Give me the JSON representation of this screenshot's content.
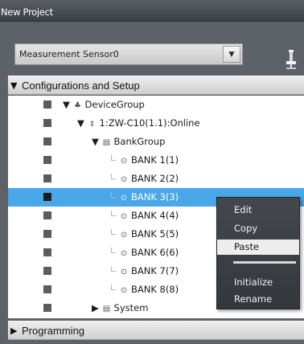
{
  "window": {
    "title": "New Project"
  },
  "dropdown": {
    "value": "Measurement Sensor0",
    "arrow": "▼"
  },
  "icons": {
    "pin": "pin-icon",
    "arrow": "dropdown-arrow-icon"
  },
  "sections": {
    "configurations": {
      "expander": "▼",
      "label": "Configurations and Setup"
    },
    "programming": {
      "expander": "▶",
      "label": "Programming"
    }
  },
  "tree": {
    "device_group": {
      "expander": "▼",
      "icon": "♣",
      "label": "DeviceGroup"
    },
    "controller": {
      "expander": "▼",
      "icon": "‡",
      "label": "1:ZW-C10(1.1):Online"
    },
    "bank_group": {
      "expander": "▼",
      "icon": "▤",
      "label": "BankGroup"
    },
    "banks": [
      {
        "label": "BANK 1(1)"
      },
      {
        "label": "BANK 2(2)"
      },
      {
        "label": "BANK 3(3)"
      },
      {
        "label": "BANK 4(4)"
      },
      {
        "label": "BANK 5(5)"
      },
      {
        "label": "BANK 6(6)"
      },
      {
        "label": "BANK 7(7)"
      },
      {
        "label": "BANK 8(8)"
      }
    ],
    "system": {
      "expander": "▶",
      "icon": "▤",
      "label": "System"
    }
  },
  "context_menu": {
    "items": [
      "Edit",
      "Copy",
      "Paste",
      "Initialize",
      "Rename"
    ],
    "highlighted": "Paste"
  },
  "colors": {
    "selection": "#4aa7e8",
    "panel": "#5d6168",
    "menu": "#3c4045"
  }
}
